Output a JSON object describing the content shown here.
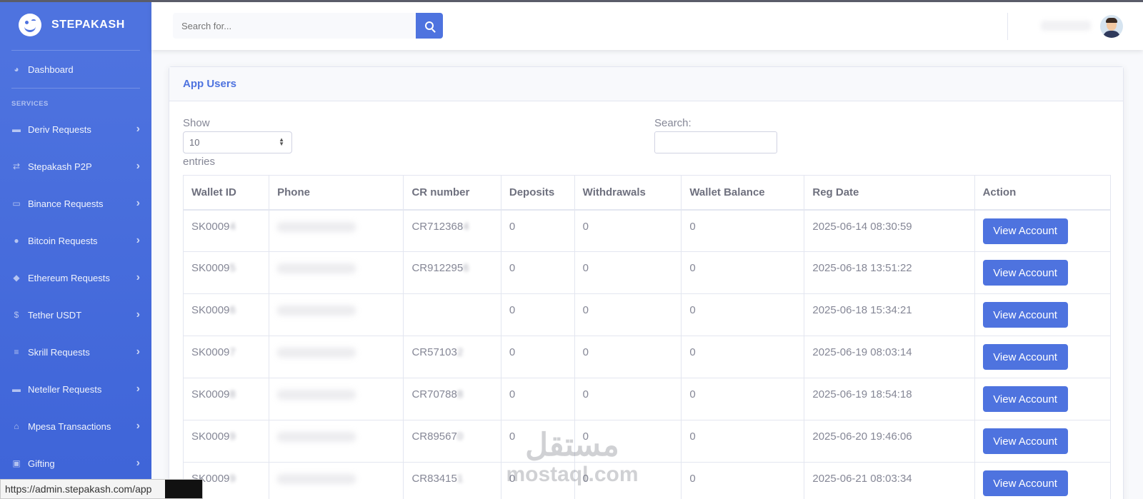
{
  "brand": {
    "name": "STEPAKASH"
  },
  "sidebar": {
    "dashboard": "Dashboard",
    "section_heading": "SERVICES",
    "items": [
      {
        "label": "Deriv Requests",
        "icon": "money-bill-icon"
      },
      {
        "label": "Stepakash P2P",
        "icon": "exchange-icon"
      },
      {
        "label": "Binance Requests",
        "icon": "credit-card-icon"
      },
      {
        "label": "Bitcoin Requests",
        "icon": "bitcoin-icon"
      },
      {
        "label": "Ethereum Requests",
        "icon": "ethereum-icon"
      },
      {
        "label": "Tether USDT",
        "icon": "dollar-icon"
      },
      {
        "label": "Skrill Requests",
        "icon": "coins-icon"
      },
      {
        "label": "Neteller Requests",
        "icon": "wallet-icon"
      },
      {
        "label": "Mpesa Transactions",
        "icon": "bank-icon"
      },
      {
        "label": "Gifting",
        "icon": "gift-icon"
      }
    ]
  },
  "topbar": {
    "search_placeholder": "Search for..."
  },
  "card": {
    "title": "App Users",
    "show_label": "Show",
    "entries_value": "10",
    "entries_label": "entries",
    "search_label": "Search:"
  },
  "table": {
    "headers": [
      "Wallet ID",
      "Phone",
      "CR number",
      "Deposits",
      "Withdrawals",
      "Wallet Balance",
      "Reg Date",
      "Action"
    ],
    "rows": [
      {
        "wallet_id": "SK0009",
        "wallet_id_hidden": "4",
        "cr": "CR712368",
        "cr_hidden": "4",
        "deposits": "0",
        "withdrawals": "0",
        "balance": "0",
        "reg_date": "2025-06-14 08:30:59",
        "action": "View Account"
      },
      {
        "wallet_id": "SK0009",
        "wallet_id_hidden": "5",
        "cr": "CR912295",
        "cr_hidden": "6",
        "deposits": "0",
        "withdrawals": "0",
        "balance": "0",
        "reg_date": "2025-06-18 13:51:22",
        "action": "View Account"
      },
      {
        "wallet_id": "SK0009",
        "wallet_id_hidden": "6",
        "cr": "",
        "cr_hidden": "",
        "deposits": "0",
        "withdrawals": "0",
        "balance": "0",
        "reg_date": "2025-06-18 15:34:21",
        "action": "View Account"
      },
      {
        "wallet_id": "SK0009",
        "wallet_id_hidden": "7",
        "cr": "CR57103",
        "cr_hidden": "2",
        "deposits": "0",
        "withdrawals": "0",
        "balance": "0",
        "reg_date": "2025-06-19 08:03:14",
        "action": "View Account"
      },
      {
        "wallet_id": "SK0009",
        "wallet_id_hidden": "8",
        "cr": "CR70788",
        "cr_hidden": "8",
        "deposits": "0",
        "withdrawals": "0",
        "balance": "0",
        "reg_date": "2025-06-19 18:54:18",
        "action": "View Account"
      },
      {
        "wallet_id": "SK0009",
        "wallet_id_hidden": "9",
        "cr": "CR89567",
        "cr_hidden": "0",
        "deposits": "0",
        "withdrawals": "0",
        "balance": "0",
        "reg_date": "2025-06-20 19:46:06",
        "action": "View Account"
      },
      {
        "wallet_id": "SK0009",
        "wallet_id_hidden": "9",
        "cr": "CR83415",
        "cr_hidden": "1",
        "deposits": "0",
        "withdrawals": "0",
        "balance": "0",
        "reg_date": "2025-06-21 08:03:34",
        "action": "View Account"
      }
    ]
  },
  "status_bar": {
    "url": "https://admin.stepakash.com/app"
  },
  "watermark": {
    "arabic": "مستقل",
    "latin": "mostaql.com"
  }
}
